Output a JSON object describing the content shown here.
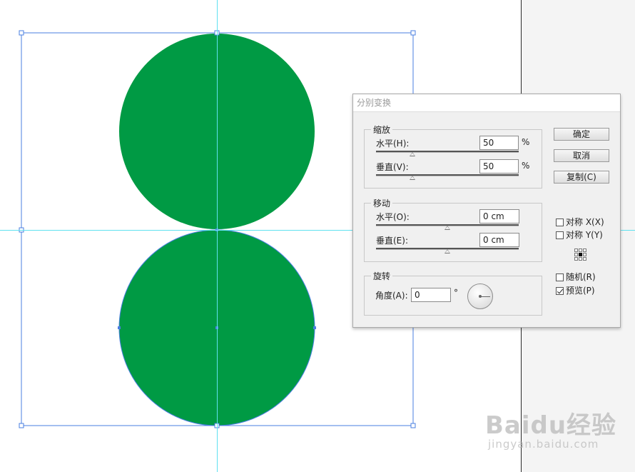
{
  "dialog": {
    "title": "分别变换",
    "scale": {
      "legend": "缩放",
      "horizontal_label": "水平(H):",
      "horizontal_value": "50",
      "horizontal_unit": "%",
      "horizontal_slider": 0.33,
      "vertical_label": "垂直(V):",
      "vertical_value": "50",
      "vertical_unit": "%",
      "vertical_slider": 0.33
    },
    "move": {
      "legend": "移动",
      "horizontal_label": "水平(O):",
      "horizontal_value": "0 cm",
      "horizontal_slider": 0.5,
      "vertical_label": "垂直(E):",
      "vertical_value": "0 cm",
      "vertical_slider": 0.5
    },
    "rotate": {
      "legend": "旋转",
      "angle_label": "角度(A):",
      "angle_value": "0",
      "angle_unit": "°"
    },
    "buttons": {
      "ok": "确定",
      "cancel": "取消",
      "copy": "复制(C)"
    },
    "options": {
      "reflect_x": {
        "label": "对称 X(X)",
        "checked": false
      },
      "reflect_y": {
        "label": "对称 Y(Y)",
        "checked": false
      },
      "random": {
        "label": "随机(R)",
        "checked": false
      },
      "preview": {
        "label": "预览(P)",
        "checked": true
      }
    }
  },
  "artwork": {
    "circle_fill": "#009A44",
    "selection_color": "#4a7fe0",
    "guide_color": "#5fe1f0"
  },
  "watermark": {
    "main": "Baidu经验",
    "sub": "jingyan.baidu.com"
  }
}
